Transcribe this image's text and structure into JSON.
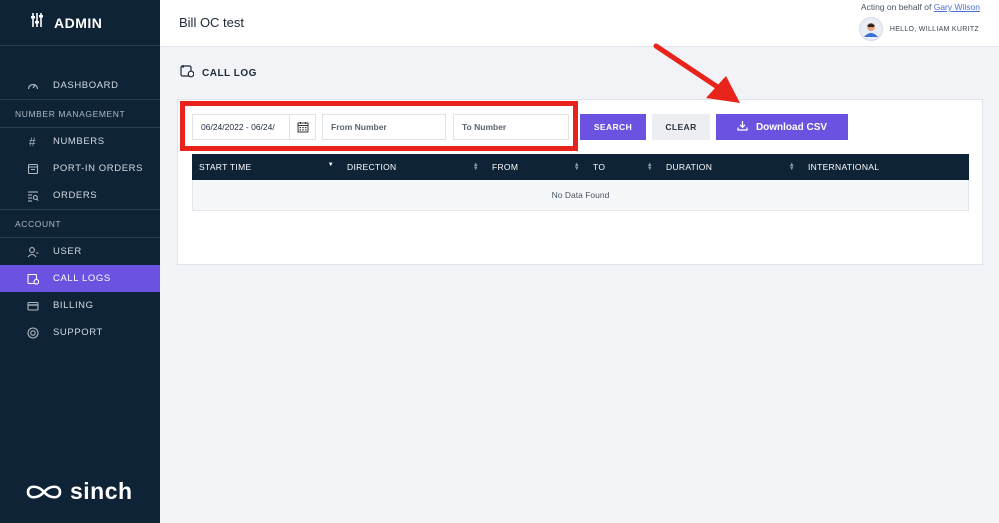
{
  "sidebar": {
    "brand": "ADMIN",
    "items": [
      {
        "type": "item",
        "label": "DASHBOARD",
        "icon": "gauge-icon",
        "active": false
      },
      {
        "type": "section",
        "label": "NUMBER MANAGEMENT"
      },
      {
        "type": "item",
        "label": "NUMBERS",
        "icon": "hash-icon",
        "active": false
      },
      {
        "type": "item",
        "label": "PORT-IN ORDERS",
        "icon": "port-in-icon",
        "active": false
      },
      {
        "type": "item",
        "label": "ORDERS",
        "icon": "orders-icon",
        "active": false
      },
      {
        "type": "section",
        "label": "ACCOUNT"
      },
      {
        "type": "item",
        "label": "USER",
        "icon": "user-icon",
        "active": false
      },
      {
        "type": "item",
        "label": "CALL LOGS",
        "icon": "call-log-icon",
        "active": true
      },
      {
        "type": "item",
        "label": "BILLING",
        "icon": "credit-card-icon",
        "active": false
      },
      {
        "type": "item",
        "label": "SUPPORT",
        "icon": "lifebuoy-icon",
        "active": false
      }
    ],
    "logo_text": "sinch"
  },
  "header": {
    "account_name": "Bill OC test",
    "acting_prefix": "Acting on behalf of",
    "acting_user": "Gary Wilson",
    "hello": "HELLO, WILLIAM KURITZ"
  },
  "page": {
    "title": "CALL LOG"
  },
  "filters": {
    "date_range": "06/24/2022 - 06/24/",
    "from_placeholder": "From Number",
    "to_placeholder": "To Number",
    "search_label": "SEARCH",
    "clear_label": "CLEAR",
    "csv_label": "Download CSV"
  },
  "table": {
    "columns": [
      "START TIME",
      "DIRECTION",
      "FROM",
      "TO",
      "DURATION",
      "INTERNATIONAL"
    ],
    "empty_text": "No Data Found"
  },
  "colors": {
    "sidebar_bg": "#0e2336",
    "accent": "#6b52e0",
    "annotation_red": "#e8231c"
  }
}
